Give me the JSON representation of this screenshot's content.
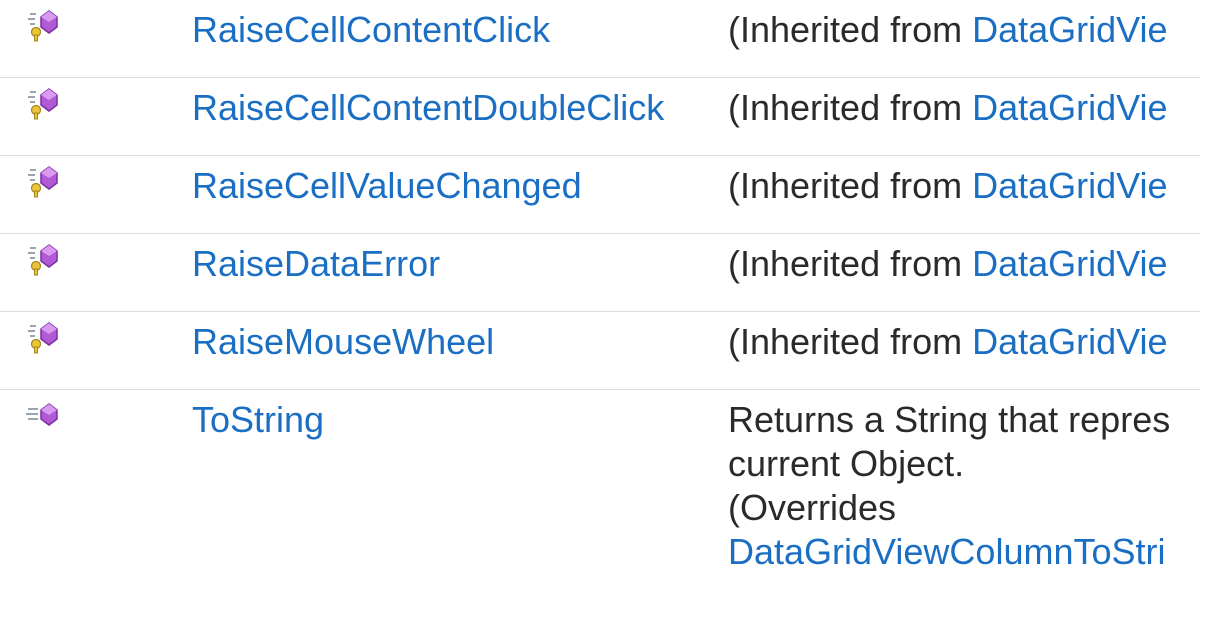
{
  "members": [
    {
      "icon": "protected-method-icon",
      "name": "RaiseCellContentClick",
      "desc_prefix": "(Inherited from ",
      "desc_link": "DataGridVie"
    },
    {
      "icon": "protected-method-icon",
      "name": "RaiseCellContentDoubleClick",
      "desc_prefix": "(Inherited from ",
      "desc_link": "DataGridVie"
    },
    {
      "icon": "protected-method-icon",
      "name": "RaiseCellValueChanged",
      "desc_prefix": "(Inherited from ",
      "desc_link": "DataGridVie"
    },
    {
      "icon": "protected-method-icon",
      "name": "RaiseDataError",
      "desc_prefix": "(Inherited from ",
      "desc_link": "DataGridVie"
    },
    {
      "icon": "protected-method-icon",
      "name": "RaiseMouseWheel",
      "desc_prefix": "(Inherited from ",
      "desc_link": "DataGridVie"
    }
  ],
  "tostring": {
    "icon": "public-method-icon",
    "name": "ToString",
    "desc_line1": "Returns a String that repres",
    "desc_line2": "current Object.",
    "desc_line3": "(Overrides",
    "desc_link": "DataGridViewColumnToStri"
  },
  "colors": {
    "link": "#1a6fc4",
    "text": "#2a2a2a",
    "divider": "#dcdcdc"
  }
}
